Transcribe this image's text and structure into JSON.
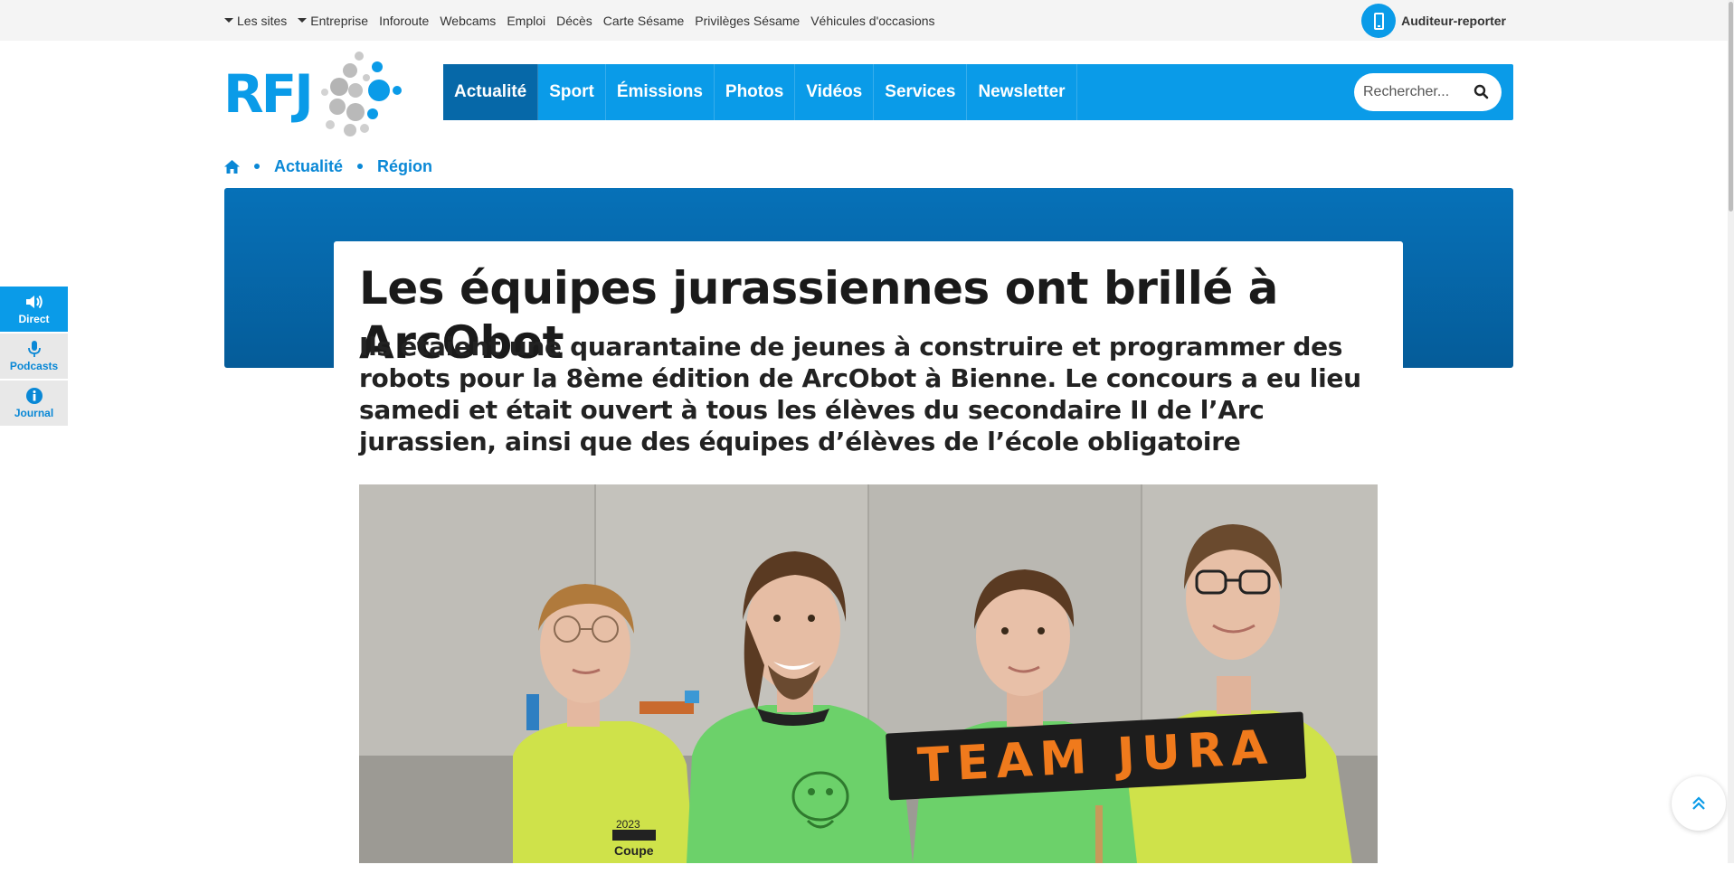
{
  "topbar": {
    "links": [
      {
        "label": "Les sites",
        "dropdown": true
      },
      {
        "label": "Entreprise",
        "dropdown": true
      },
      {
        "label": "Inforoute",
        "dropdown": false
      },
      {
        "label": "Webcams",
        "dropdown": false
      },
      {
        "label": "Emploi",
        "dropdown": false
      },
      {
        "label": "Décès",
        "dropdown": false
      },
      {
        "label": "Carte Sésame",
        "dropdown": false
      },
      {
        "label": "Privilèges Sésame",
        "dropdown": false
      },
      {
        "label": "Véhicules d'occasions",
        "dropdown": false
      }
    ],
    "reporter_label": "Auditeur-reporter",
    "reporter_icon": "smartphone-icon"
  },
  "logo": {
    "text": "RFJ"
  },
  "nav": {
    "items": [
      "Actualité",
      "Sport",
      "Émissions",
      "Photos",
      "Vidéos",
      "Services",
      "Newsletter"
    ],
    "active": "Actualité",
    "search_placeholder": "Rechercher..."
  },
  "breadcrumb": {
    "home_icon": "home-icon",
    "items": [
      "Actualité",
      "Région"
    ]
  },
  "article": {
    "title": "Les équipes jurassiennes ont brillé à ArcObot",
    "lead": "Ils étaient une quarantaine de jeunes à construire et programmer des robots pour la 8ème édition de ArcObot à Bienne. Le concours a eu lieu samedi et était ouvert à tous les élèves du secondaire II de l’Arc jurassien, ainsi que des équipes d’élèves de l’école obligatoire",
    "photo_sign": "TEAM JURA",
    "shirt_text_1": "2023",
    "shirt_text_2": "Coupe"
  },
  "player": {
    "items": [
      {
        "label": "Direct",
        "icon": "speaker-icon"
      },
      {
        "label": "Podcasts",
        "icon": "microphone-icon"
      },
      {
        "label": "Journal",
        "icon": "info-icon"
      }
    ]
  },
  "colors": {
    "brand_blue": "#0a9be8",
    "nav_active": "#0668a8",
    "hero_band": "#0671b8",
    "link_blue": "#0a88d6"
  }
}
